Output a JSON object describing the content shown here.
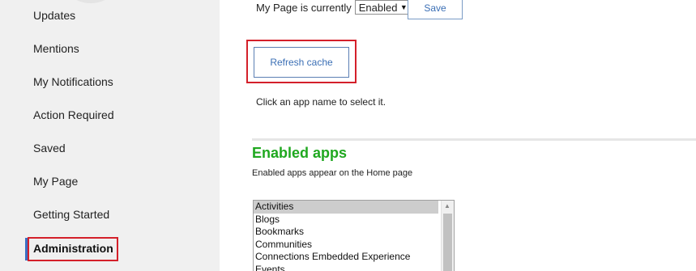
{
  "sidebar": {
    "items": [
      {
        "label": "Updates"
      },
      {
        "label": "Mentions"
      },
      {
        "label": "My Notifications"
      },
      {
        "label": "Action Required"
      },
      {
        "label": "Saved"
      },
      {
        "label": "My Page"
      },
      {
        "label": "Getting Started"
      },
      {
        "label": "Administration",
        "active": true
      }
    ]
  },
  "status": {
    "text": "My Page is currently",
    "select_value": "Enabled",
    "save_label": "Save"
  },
  "refresh_label": "Refresh cache",
  "hint": "Click an app name to select it.",
  "enabled_apps": {
    "title": "Enabled apps",
    "subtitle": "Enabled apps appear on the Home page",
    "items": [
      "Activities",
      "Blogs",
      "Bookmarks",
      "Communities",
      "Connections Embedded Experience",
      "Events"
    ]
  },
  "colors": {
    "accent": "#3b6fc3",
    "highlight": "#d4202a",
    "title_green": "#1fa81f"
  }
}
